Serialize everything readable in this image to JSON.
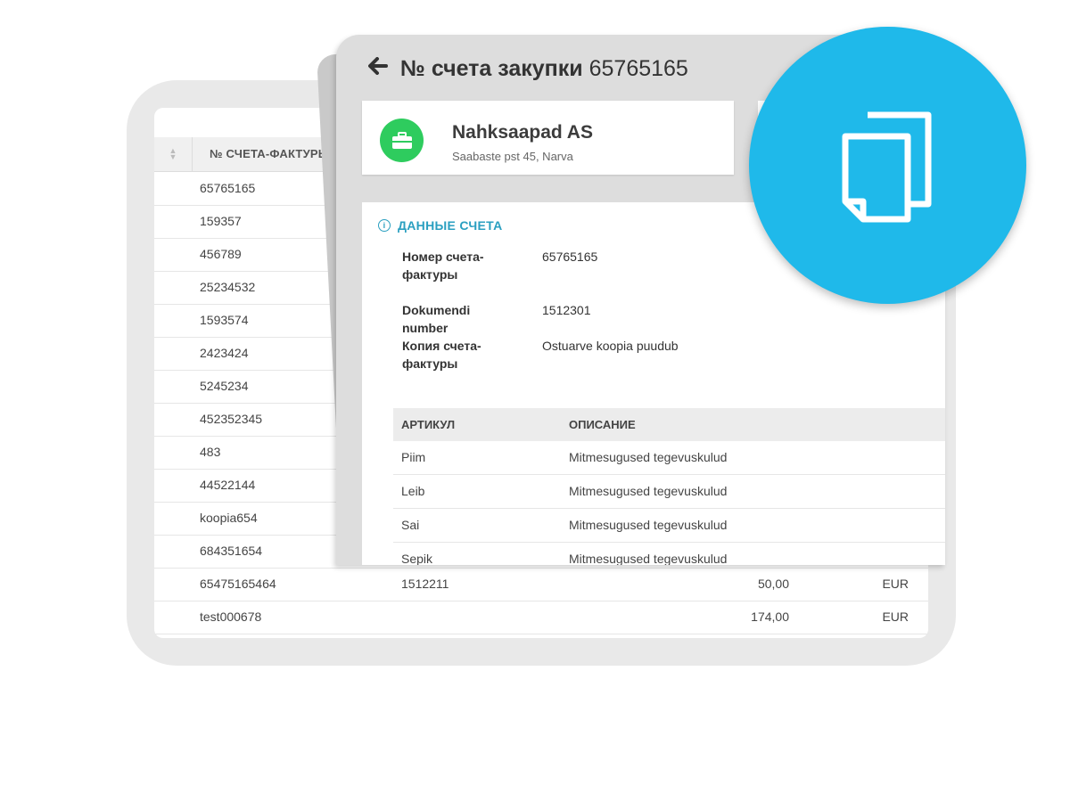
{
  "invoice_list": {
    "column_header": "№ СЧЕТА-ФАКТУРЫ",
    "rows": [
      {
        "invoice": "65765165",
        "document": "",
        "amount": "",
        "currency": ""
      },
      {
        "invoice": "159357",
        "document": "",
        "amount": "",
        "currency": ""
      },
      {
        "invoice": "456789",
        "document": "",
        "amount": "",
        "currency": ""
      },
      {
        "invoice": "25234532",
        "document": "",
        "amount": "",
        "currency": ""
      },
      {
        "invoice": "1593574",
        "document": "",
        "amount": "",
        "currency": ""
      },
      {
        "invoice": "2423424",
        "document": "",
        "amount": "",
        "currency": ""
      },
      {
        "invoice": "5245234",
        "document": "",
        "amount": "",
        "currency": ""
      },
      {
        "invoice": "452352345",
        "document": "",
        "amount": "",
        "currency": ""
      },
      {
        "invoice": "483",
        "document": "",
        "amount": "",
        "currency": ""
      },
      {
        "invoice": "44522144",
        "document": "",
        "amount": "",
        "currency": ""
      },
      {
        "invoice": "koopia654",
        "document": "",
        "amount": "",
        "currency": ""
      },
      {
        "invoice": "684351654",
        "document": "",
        "amount": "",
        "currency": ""
      },
      {
        "invoice": "65475165464",
        "document": "1512211",
        "amount": "50,00",
        "currency": "EUR"
      },
      {
        "invoice": "test000678",
        "document": "",
        "amount": "174,00",
        "currency": "EUR"
      }
    ]
  },
  "modal": {
    "title_bold": "№ счета закупки",
    "title_number": "65765165",
    "company": {
      "name": "Nahksaapad AS",
      "address": "Saabaste pst 45, Narva"
    },
    "section_title": "ДАННЫЕ СЧЕТА",
    "fields": {
      "invoice_number_label": "Номер счета-фактуры",
      "invoice_number_value": "65765165",
      "document_number_label": "Dokumendi number",
      "document_number_value": "1512301",
      "copy_label": "Копия счета-фактуры",
      "copy_value": "Ostuarve koopia puudub"
    },
    "items_table": {
      "headers": {
        "article": "АРТИКУЛ",
        "description": "ОПИСАНИЕ"
      },
      "rows": [
        {
          "article": "Piim",
          "description": "Mitmesugused tegevuskulud"
        },
        {
          "article": "Leib",
          "description": "Mitmesugused tegevuskulud"
        },
        {
          "article": "Sai",
          "description": "Mitmesugused tegevuskulud"
        },
        {
          "article": "Sepik",
          "description": "Mitmesugused tegevuskulud"
        }
      ]
    }
  },
  "icons": {
    "back": "arrow-left-icon",
    "company": "briefcase-icon",
    "info": "info-icon",
    "badge": "documents-copy-icon"
  },
  "colors": {
    "accent_blue": "#1fb9ea",
    "section_blue": "#2a9fc0",
    "company_green": "#2ecc5e"
  }
}
